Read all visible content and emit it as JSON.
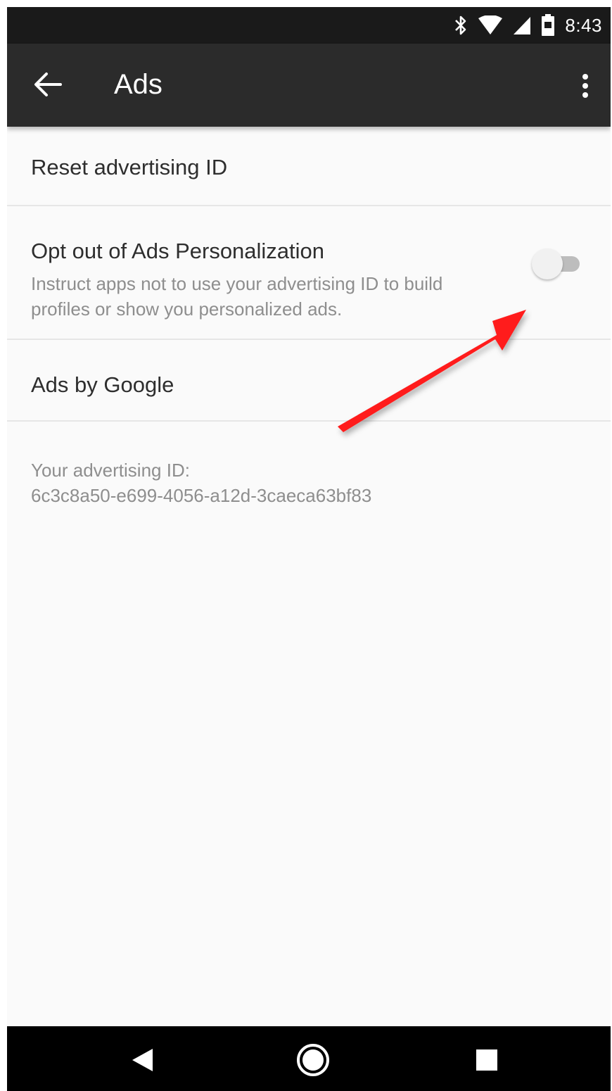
{
  "status_bar": {
    "time": "8:43",
    "icons": [
      "bluetooth-icon",
      "wifi-icon",
      "signal-icon",
      "battery-icon"
    ]
  },
  "app_bar": {
    "title": "Ads",
    "back_icon": "arrow-left-icon",
    "overflow_icon": "more-vert-icon"
  },
  "preferences": {
    "reset": {
      "title": "Reset advertising ID"
    },
    "opt_out": {
      "title": "Opt out of Ads Personalization",
      "summary": "Instruct apps not to use your advertising ID to build profiles or show you personalized ads.",
      "switch_on": false
    },
    "ads_by_google": {
      "title": "Ads by Google"
    }
  },
  "advertising_id": {
    "label": "Your advertising ID:",
    "value": "6c3c8a50-e699-4056-a12d-3caeca63bf83"
  },
  "annotation": {
    "arrow_color": "#ff1a1a"
  },
  "colors": {
    "status_bar": "#1a1a1a",
    "app_bar": "#2b2b2b",
    "background": "#fafafa",
    "primary_text": "#2e2e2e",
    "secondary_text": "#8e8e8e"
  },
  "nav_bar": {
    "icons": [
      "back-triangle-icon",
      "home-circle-icon",
      "recents-square-icon"
    ]
  }
}
